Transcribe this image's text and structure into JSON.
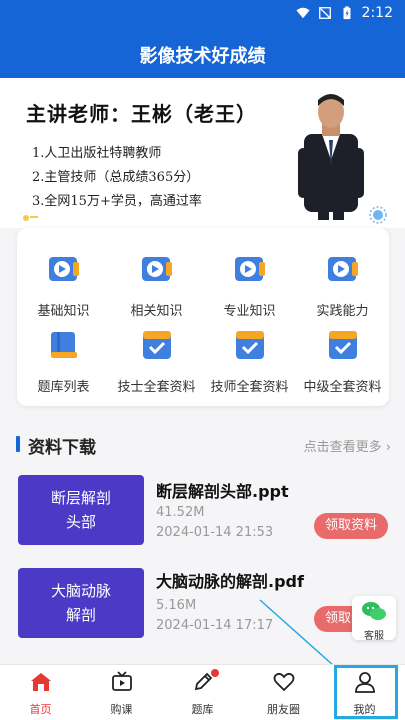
{
  "status_bar": {
    "time": "2:12"
  },
  "header": {
    "title": "影像技术好成绩"
  },
  "banner": {
    "teacher": "主讲老师：王彬（老王）",
    "bullets": [
      "1.人卫出版社特聘教师",
      "2.主管技师（总成绩365分）",
      "3.全网15万+学员，高通过率"
    ]
  },
  "grid": [
    {
      "label": "基础知识",
      "icon": "video-icon"
    },
    {
      "label": "相关知识",
      "icon": "video-icon"
    },
    {
      "label": "专业知识",
      "icon": "video-icon"
    },
    {
      "label": "实践能力",
      "icon": "video-icon"
    },
    {
      "label": "题库列表",
      "icon": "book-icon"
    },
    {
      "label": "技士全套资料",
      "icon": "checklist-icon"
    },
    {
      "label": "技师全套资料",
      "icon": "checklist-icon"
    },
    {
      "label": "中级全套资料",
      "icon": "checklist-icon"
    }
  ],
  "section": {
    "title": "资料下载",
    "more": "点击查看更多"
  },
  "files": [
    {
      "thumb_line1": "断层解剖",
      "thumb_line2": "头部",
      "name": "断层解剖头部.ppt",
      "size": "41.52M",
      "date": "2024-01-14 21:53",
      "action": "领取资料"
    },
    {
      "thumb_line1": "大脑动脉",
      "thumb_line2": "解剖",
      "name": "大脑动脉的解剖.pdf",
      "size": "5.16M",
      "date": "2024-01-14 17:17",
      "action": "领取资料"
    }
  ],
  "kefu": {
    "label": "客服",
    "icon": "wechat-icon"
  },
  "colors": {
    "primary": "#1565d6",
    "accent": "#e53935",
    "thumb": "#4c3ac7",
    "button": "#e96a6a",
    "highlight": "#26a9e0"
  },
  "nav": [
    {
      "label": "首页",
      "icon": "home-icon",
      "active": true
    },
    {
      "label": "购课",
      "icon": "tv-icon"
    },
    {
      "label": "题库",
      "icon": "pencil-icon"
    },
    {
      "label": "朋友圈",
      "icon": "heart-icon"
    },
    {
      "label": "我的",
      "icon": "user-icon"
    }
  ]
}
